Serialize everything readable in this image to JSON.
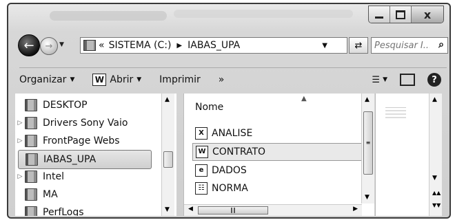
{
  "address": {
    "crumbs": [
      "«",
      "SISTEMA (C:)",
      "IABAS_UPA"
    ]
  },
  "search": {
    "placeholder": "Pesquisar I..."
  },
  "toolbar": {
    "organize_label": "Organizar",
    "open_label": "Abrir",
    "print_label": "Imprimir",
    "more_label": "»"
  },
  "nav": {
    "items": [
      {
        "label": "DESKTOP"
      },
      {
        "label": "Drivers Sony Vaio"
      },
      {
        "label": "FrontPage Webs"
      },
      {
        "label": "IABAS_UPA"
      },
      {
        "label": "Intel"
      },
      {
        "label": "MA"
      },
      {
        "label": "PerfLogs"
      }
    ]
  },
  "files": {
    "column_name": "Nome",
    "items": [
      {
        "label": "ANALISE"
      },
      {
        "label": "CONTRATO"
      },
      {
        "label": "DADOS"
      },
      {
        "label": "NORMA"
      }
    ]
  }
}
